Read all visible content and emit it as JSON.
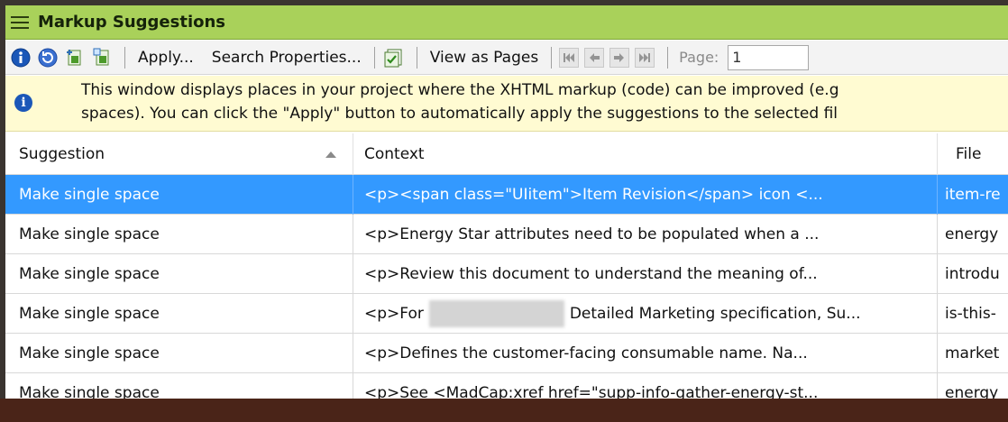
{
  "window": {
    "title": "Markup Suggestions"
  },
  "toolbar": {
    "apply_label": "Apply...",
    "search_properties_label": "Search Properties...",
    "view_as_pages_label": "View as Pages",
    "page_label": "Page:",
    "page_value": "1"
  },
  "info": {
    "line1": "This window displays places in your project where the XHTML markup (code) can be improved (e.g",
    "line2": "spaces). You can click the \"Apply\" button to automatically apply the suggestions to the selected fil"
  },
  "table": {
    "columns": [
      "Suggestion",
      "Context",
      "File"
    ],
    "rows": [
      {
        "suggestion": "Make single space",
        "context": "<p><span class=\"UIitem\">Item Revision</span>  icon <...",
        "file": "item-re",
        "selected": true
      },
      {
        "suggestion": "Make single space",
        "context": "<p>Energy Star attributes need to be populated when a ...",
        "file": "energy"
      },
      {
        "suggestion": "Make single space",
        "context": "<p>Review this document  to understand the meaning of...",
        "file": "introdu"
      },
      {
        "suggestion": "Make single space",
        "context_a": "<p>For",
        "context_b": "Detailed Marketing specification, Su...",
        "file": "is-this-"
      },
      {
        "suggestion": "Make single space",
        "context": "<p>Defines the customer-facing consumable name. Na...",
        "file": "market"
      },
      {
        "suggestion": "Make single space",
        "context": "<p>See <MadCap:xref href=\"supp-info-gather-energy-st...",
        "file": "energy"
      }
    ]
  },
  "colors": {
    "titlebar": "#a9d15a",
    "selection": "#3399ff",
    "info_background": "#fffbd2"
  }
}
